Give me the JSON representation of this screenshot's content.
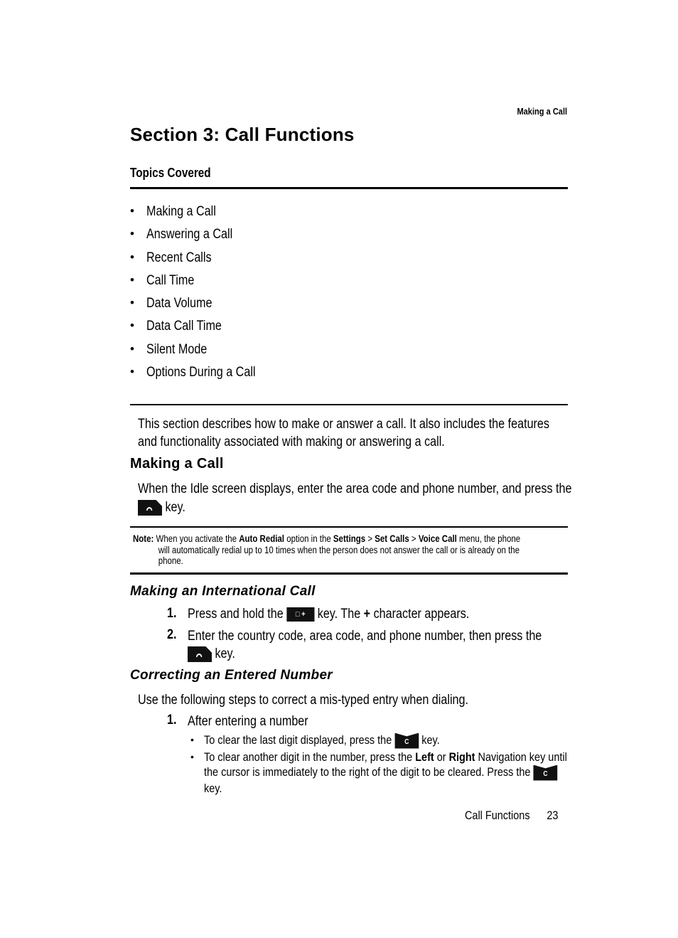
{
  "running_header": "Making a Call",
  "section_title": "Section 3:  Call Functions",
  "topics": {
    "heading": "Topics Covered",
    "items": [
      "Making a Call",
      "Answering a Call",
      "Recent Calls",
      "Call Time",
      "Data Volume",
      "Data Call Time",
      "Silent Mode",
      "Options During a Call"
    ]
  },
  "intro": {
    "line1": "This section describes how to make or answer a call. It also includes the features",
    "line2": "and functionality associated with making or answering a call."
  },
  "making_a_call": {
    "heading": "Making a Call",
    "line1": "When the Idle screen displays, enter the area code and phone number, and press the",
    "line2_after_key": " key.",
    "key_icon": "send-key-icon"
  },
  "note": {
    "label": "Note:",
    "t1": " When you activate the ",
    "b1": "Auto Redial",
    "t2": " option in the ",
    "b2": "Settings",
    "t3": " > ",
    "b3": "Set Calls",
    "t4": " > ",
    "b4": "Voice Call",
    "t5": " menu, the phone",
    "line2": "will automatically redial up to 10 times when the person does not answer the call or is already on the",
    "line3": "phone."
  },
  "international": {
    "heading": "Making an International Call",
    "steps": [
      {
        "num": "1.",
        "before": "Press and hold the ",
        "key_label": "□ +",
        "after1": " key. The ",
        "bold": "+",
        "after2": " character appears."
      },
      {
        "num": "2.",
        "line1": "Enter the country code, area code, and phone number, then press the",
        "line2_after_key": " key."
      }
    ]
  },
  "correcting": {
    "heading": "Correcting an Entered Number",
    "intro": "Use the following steps to correct a mis-typed entry when dialing.",
    "step1": {
      "num": "1.",
      "text": "After entering a number"
    },
    "bullets": [
      {
        "before": "To clear the last digit displayed, press the ",
        "key_label": "C",
        "after": " key."
      },
      {
        "t1": "To clear another digit in the number, press the ",
        "b1": "Left",
        "t2": " or ",
        "b2": "Right",
        "t3": " Navigation key until",
        "line2": "the cursor is immediately to the right of the digit to be cleared. Press the ",
        "key_label": "C",
        "line3": "key."
      }
    ]
  },
  "footer": {
    "section": "Call Functions",
    "page": "23"
  }
}
